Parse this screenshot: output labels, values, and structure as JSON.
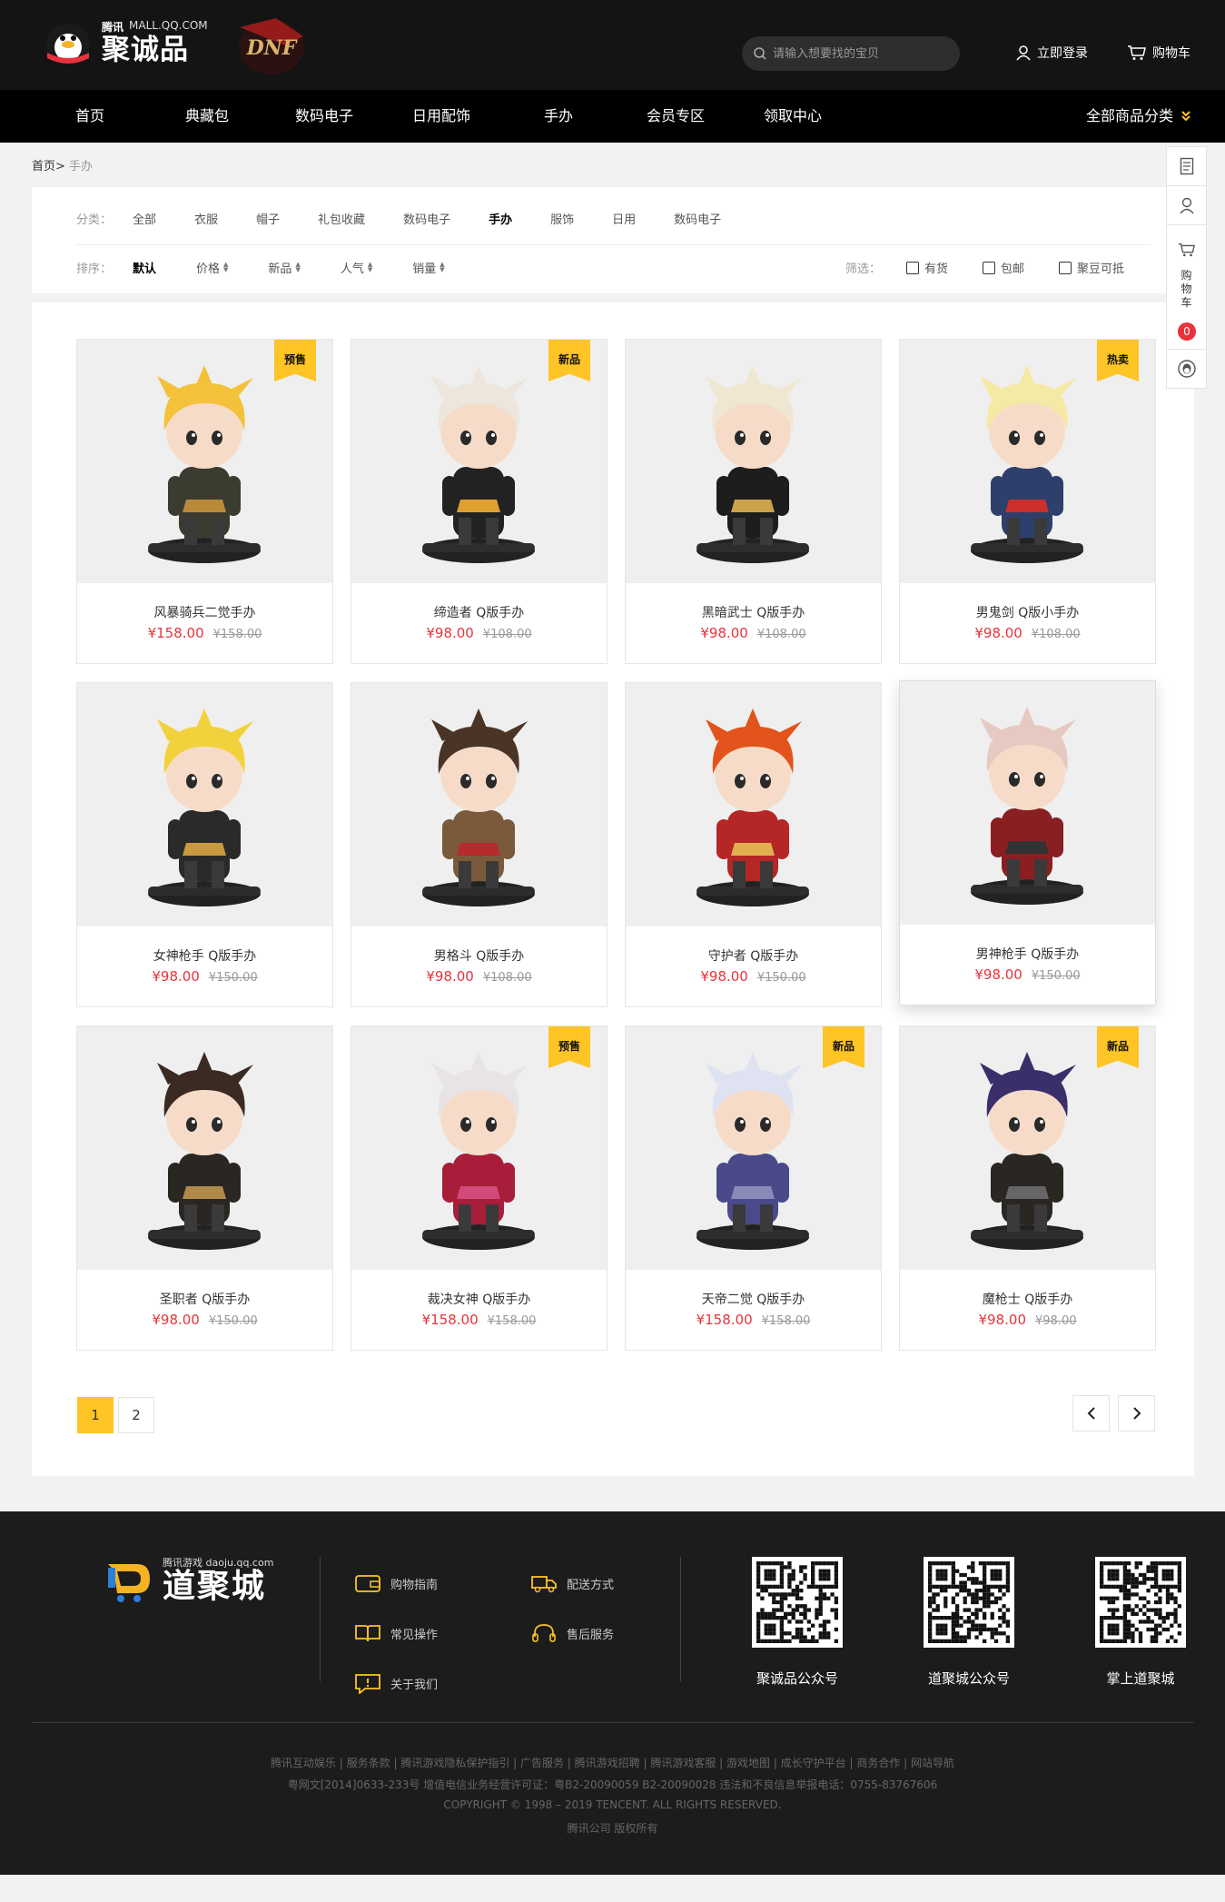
{
  "header": {
    "brand_small_1": "腾讯",
    "brand_small_2": "MALL.QQ.COM",
    "brand_big": "聚诚品",
    "game_logo_text": "DNF",
    "search_placeholder": "请输入想要找的宝贝",
    "login_label": "立即登录",
    "cart_label": "购物车",
    "accent_color": "#ffc425"
  },
  "nav": {
    "items": [
      "首页",
      "典藏包",
      "数码电子",
      "日用配饰",
      "手办",
      "会员专区",
      "领取中心"
    ],
    "all_categories": "全部商品分类"
  },
  "breadcrumb": {
    "home": "首页>",
    "current": "手办"
  },
  "filter": {
    "category_label": "分类：",
    "categories": [
      "全部",
      "衣服",
      "帽子",
      "礼包收藏",
      "数码电子",
      "手办",
      "服饰",
      "日用",
      "数码电子"
    ],
    "active_category_index": 5,
    "sort_label": "排序：",
    "sort_options": [
      "默认",
      "价格",
      "新品",
      "人气",
      "销量"
    ],
    "screen_label": "筛选：",
    "checkboxes": [
      "有货",
      "包邮",
      "聚豆可抵"
    ]
  },
  "products": [
    {
      "name": "风暴骑兵二觉手办",
      "price": "¥158.00",
      "old_price": "¥158.00",
      "tag": "预售",
      "hair": "#f3c23a",
      "outfit": "#3b3b2f",
      "accent": "#b88a3a"
    },
    {
      "name": "缔造者 Q版手办",
      "price": "¥98.00",
      "old_price": "¥108.00",
      "tag": "新品",
      "hair": "#ece6dc",
      "outfit": "#222222",
      "accent": "#e0a030"
    },
    {
      "name": "黑暗武士 Q版手办",
      "price": "¥98.00",
      "old_price": "¥108.00",
      "tag": "",
      "hair": "#efe7d2",
      "outfit": "#1d1d1d",
      "accent": "#c9a24a"
    },
    {
      "name": "男鬼剑 Q版小手办",
      "price": "¥98.00",
      "old_price": "¥108.00",
      "tag": "热卖",
      "hair": "#f5e9a6",
      "outfit": "#2d3f6a",
      "accent": "#c9302c"
    },
    {
      "name": "女神枪手 Q版手办",
      "price": "¥98.00",
      "old_price": "¥150.00",
      "tag": "",
      "hair": "#f2d23c",
      "outfit": "#2a2a2a",
      "accent": "#c89a40"
    },
    {
      "name": "男格斗 Q版手办",
      "price": "¥98.00",
      "old_price": "¥108.00",
      "tag": "",
      "hair": "#4a3426",
      "outfit": "#7a5a3a",
      "accent": "#b52b2b"
    },
    {
      "name": "守护者 Q版手办",
      "price": "¥98.00",
      "old_price": "¥150.00",
      "tag": "",
      "hair": "#e2541c",
      "outfit": "#b52626",
      "accent": "#e0b050"
    },
    {
      "name": "男神枪手 Q版手办",
      "price": "¥98.00",
      "old_price": "¥150.00",
      "tag": "",
      "hair": "#e6c9c0",
      "outfit": "#8a1f22",
      "accent": "#333333"
    },
    {
      "name": "圣职者 Q版手办",
      "price": "¥98.00",
      "old_price": "¥150.00",
      "tag": "",
      "hair": "#3a2a22",
      "outfit": "#2a2622",
      "accent": "#b08a4a"
    },
    {
      "name": "裁决女神 Q版手办",
      "price": "¥158.00",
      "old_price": "¥158.00",
      "tag": "预售",
      "hair": "#e8e4e6",
      "outfit": "#a81e3a",
      "accent": "#d24a7a"
    },
    {
      "name": "天帝二觉 Q版手办",
      "price": "¥158.00",
      "old_price": "¥158.00",
      "tag": "新品",
      "hair": "#dfe2f0",
      "outfit": "#4a4a8a",
      "accent": "#8a8ab8"
    },
    {
      "name": "魔枪士 Q版手办",
      "price": "¥98.00",
      "old_price": "¥98.00",
      "tag": "新品",
      "hair": "#3a2f6a",
      "outfit": "#2a2622",
      "accent": "#666666"
    }
  ],
  "pagination": {
    "pages": [
      "1",
      "2"
    ],
    "active": "1"
  },
  "sidebar": {
    "cart_text": "购物车",
    "cart_count": "0"
  },
  "footer": {
    "logo_small": "腾讯游戏 daoju.qq.com",
    "logo_big": "道聚城",
    "links": [
      "购物指南",
      "配送方式",
      "常见操作",
      "售后服务",
      "关于我们"
    ],
    "qr_labels": [
      "聚诚品公众号",
      "道聚城公众号",
      "掌上道聚城"
    ],
    "legal_line1": "腾讯互动娱乐 | 服务条款 | 腾讯游戏隐私保护指引 | 广告服务 | 腾讯游戏招聘 | 腾讯游戏客服 | 游戏地图 | 成长守护平台 | 商务合作 | 网站导航",
    "legal_line2": "粤网文[2014]0633-233号 增值电信业务经营许可证：粤B2-20090059 B2-20090028 违法和不良信息举报电话：0755-83767606",
    "legal_line3": "COPYRIGHT © 1998 – 2019 TENCENT. ALL RIGHTS RESERVED.",
    "legal_line4": "腾讯公司 版权所有"
  }
}
